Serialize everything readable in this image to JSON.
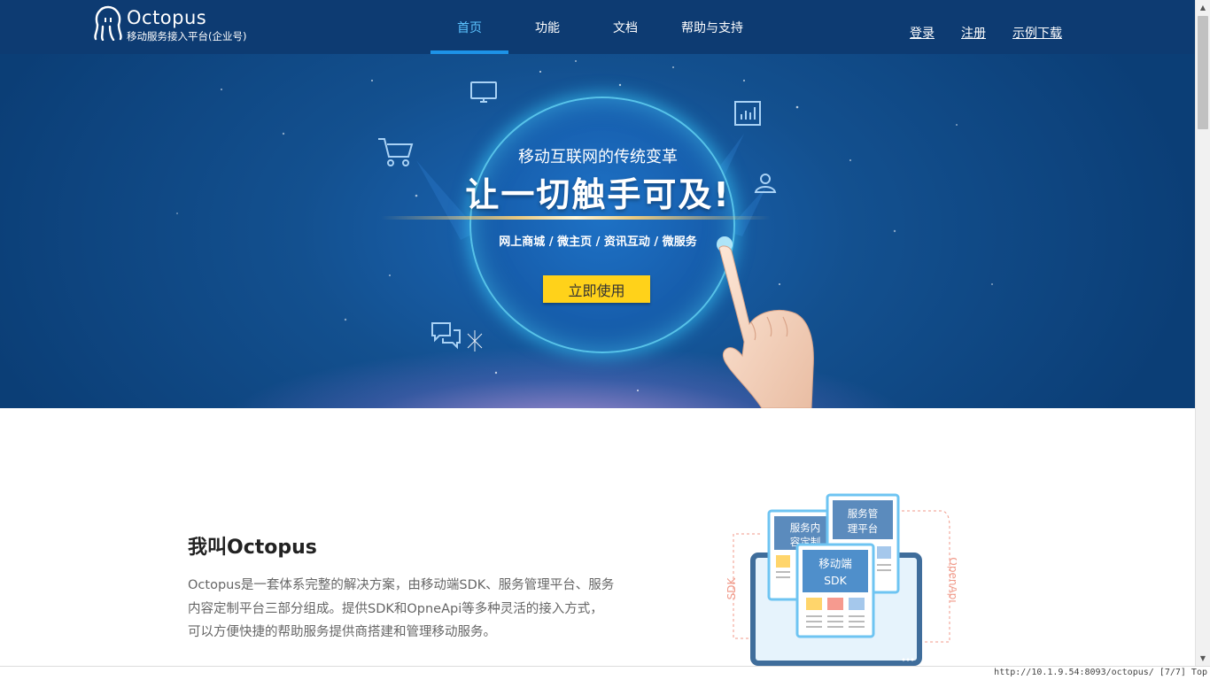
{
  "header": {
    "logo_name": "Octopus",
    "logo_subtitle": "移动服务接入平台(企业号)",
    "nav": [
      {
        "label": "首页",
        "active": true
      },
      {
        "label": "功能",
        "active": false
      },
      {
        "label": "文档",
        "active": false
      },
      {
        "label": "帮助与支持",
        "active": false
      }
    ],
    "auth": {
      "login": "登录",
      "register": "注册",
      "download": "示例下载"
    }
  },
  "banner": {
    "subtitle": "移动互联网的传统变革",
    "title": "让一切触手可及!",
    "tags": "网上商城 / 微主页 / 资讯互动 / 微服务",
    "cta_label": "立即使用",
    "icons": [
      "monitor-icon",
      "shopping-cart-icon",
      "bar-chart-icon",
      "user-icon",
      "chat-bubbles-icon"
    ]
  },
  "intro": {
    "title": "我叫Octopus",
    "lines": [
      "Octopus是一套体系完整的解决方案，由移动端SDK、服务管理平台、服务",
      "内容定制平台三部分组成。提供SDK和OpneApi等多种灵活的接入方式，",
      "可以方便快捷的帮助服务提供商搭建和管理移动服务。"
    ],
    "illustration": {
      "card_left": [
        "服务内",
        "容定制"
      ],
      "card_right": [
        "服务管",
        "理平台"
      ],
      "card_front": [
        "移动端",
        "SDK"
      ],
      "label_left": "SDK",
      "label_right": "OpenApi"
    }
  },
  "statusbar": {
    "text": "http://10.1.9.54:8093/octopus/ [7/7] Top"
  },
  "colors": {
    "header_bg": "#0d3b72",
    "accent": "#1d93e8",
    "cta": "#ffd21a"
  }
}
